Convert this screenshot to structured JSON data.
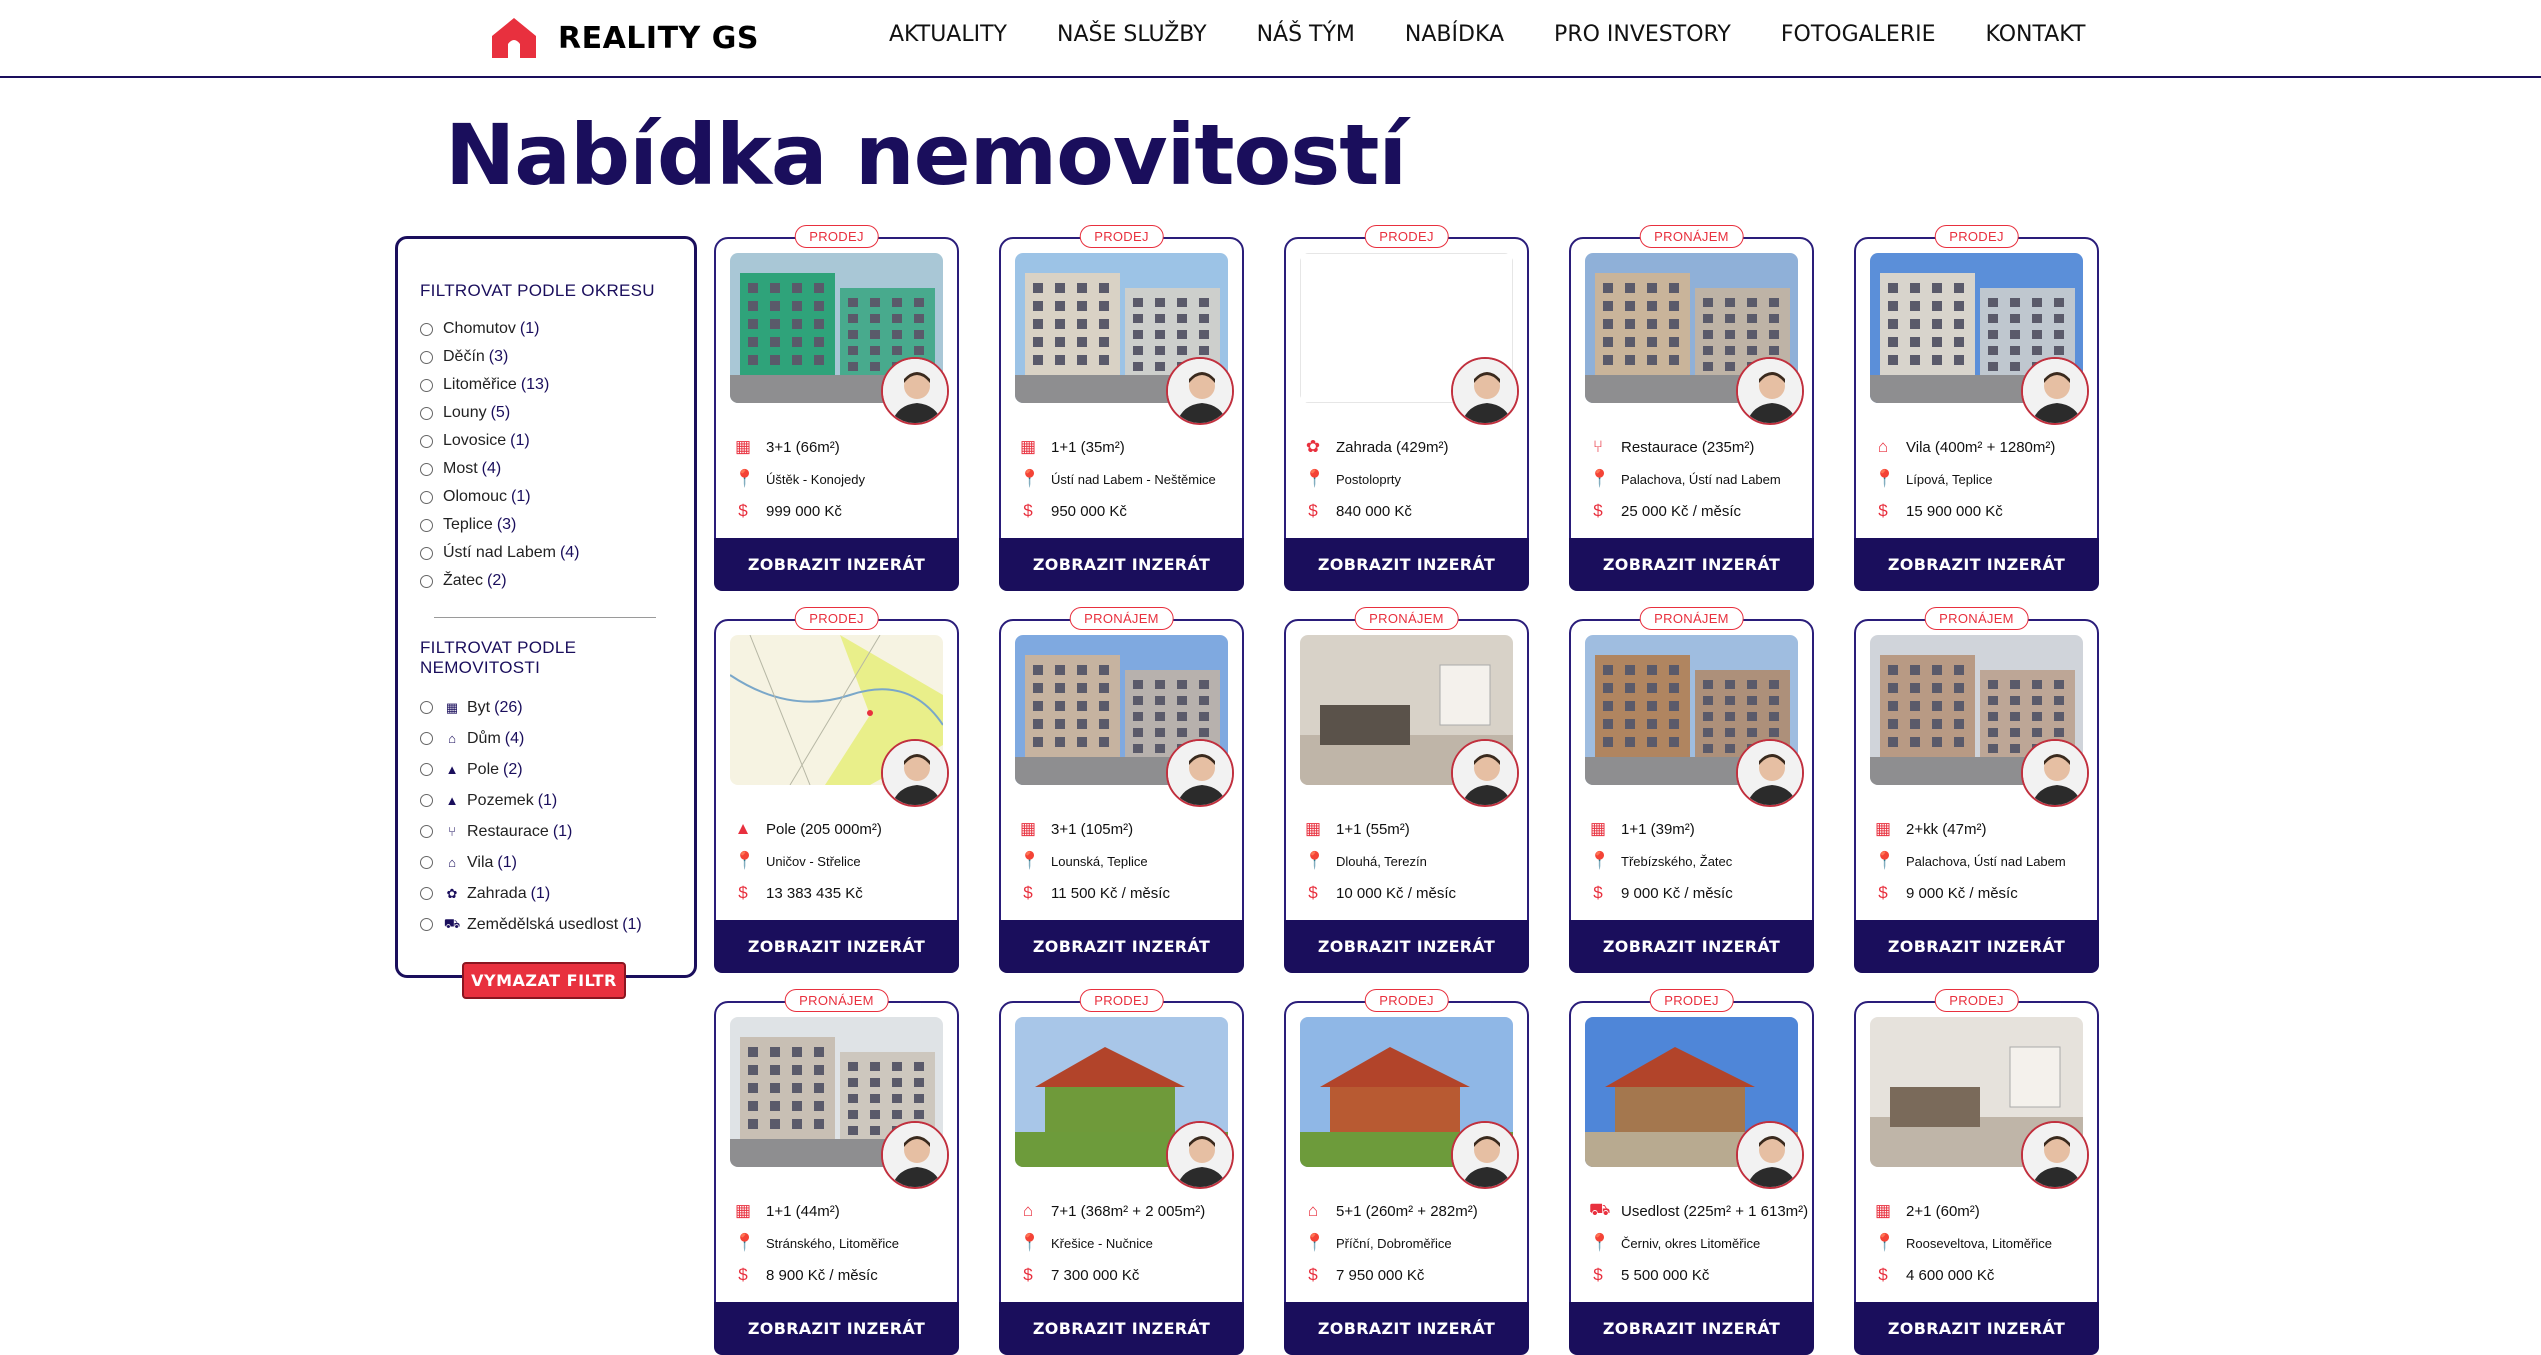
{
  "brand": {
    "name": "REALITY GS"
  },
  "nav": [
    "AKTUALITY",
    "NAŠE SLUŽBY",
    "NÁŠ TÝM",
    "NABÍDKA",
    "PRO INVESTORY",
    "FOTOGALERIE",
    "KONTAKT"
  ],
  "page_title": "Nabídka nemovitostí",
  "sidebar": {
    "district_heading": "FILTROVAT PODLE OKRESU",
    "districts": [
      {
        "label": "Chomutov",
        "count": "(1)"
      },
      {
        "label": "Děčín",
        "count": "(3)"
      },
      {
        "label": "Litoměřice",
        "count": "(13)"
      },
      {
        "label": "Louny",
        "count": "(5)"
      },
      {
        "label": "Lovosice",
        "count": "(1)"
      },
      {
        "label": "Most",
        "count": "(4)"
      },
      {
        "label": "Olomouc",
        "count": "(1)"
      },
      {
        "label": "Teplice",
        "count": "(3)"
      },
      {
        "label": "Ústí nad Labem",
        "count": "(4)"
      },
      {
        "label": "Žatec",
        "count": "(2)"
      }
    ],
    "type_heading": "FILTROVAT PODLE NEMOVITOSTI",
    "types": [
      {
        "label": "Byt",
        "count": "(26)",
        "icon": "building-icon"
      },
      {
        "label": "Dům",
        "count": "(4)",
        "icon": "house-icon"
      },
      {
        "label": "Pole",
        "count": "(2)",
        "icon": "field-icon"
      },
      {
        "label": "Pozemek",
        "count": "(1)",
        "icon": "land-icon"
      },
      {
        "label": "Restaurace",
        "count": "(1)",
        "icon": "restaurant-icon"
      },
      {
        "label": "Vila",
        "count": "(1)",
        "icon": "villa-icon"
      },
      {
        "label": "Zahrada",
        "count": "(1)",
        "icon": "garden-icon"
      },
      {
        "label": "Zemědělská usedlost",
        "count": "(1)",
        "icon": "farm-icon"
      }
    ],
    "clear_button": "VYMAZAT FILTR"
  },
  "card_button": "ZOBRAZIT INZERÁT",
  "listings": [
    {
      "badge": "PRODEJ",
      "title": "3+1 (66m²)",
      "location": "Úštěk - Konojedy",
      "price": "999 000 Kč",
      "icon": "building-icon",
      "photo": "green-apartment-block",
      "colors": [
        "#2fa37a",
        "#a9c7d6"
      ]
    },
    {
      "badge": "PRODEJ",
      "title": "1+1 (35m²)",
      "location": "Ústí nad Labem - Neštěmice",
      "price": "950 000 Kč",
      "icon": "building-icon",
      "photo": "apartment-block",
      "colors": [
        "#d9d2c5",
        "#9cc3e6"
      ]
    },
    {
      "badge": "PRODEJ",
      "title": "Zahrada (429m²)",
      "location": "Postoloprty",
      "price": "840 000 Kč",
      "icon": "garden-icon",
      "photo": "broken-image",
      "colors": [
        "#ffffff",
        "#ffffff"
      ]
    },
    {
      "badge": "PRONÁJEM",
      "title": "Restaurace (235m²)",
      "location": "Palachova, Ústí nad Labem",
      "price": "25 000 Kč / měsíc",
      "icon": "restaurant-icon",
      "photo": "street-buildings",
      "colors": [
        "#c9b49a",
        "#8fb0d8"
      ]
    },
    {
      "badge": "PRODEJ",
      "title": "Vila (400m² + 1280m²)",
      "location": "Lípová, Teplice",
      "price": "15 900 000 Kč",
      "icon": "villa-icon",
      "photo": "villa",
      "colors": [
        "#d8d4cc",
        "#5b8fd9"
      ]
    },
    {
      "badge": "PRODEJ",
      "title": "Pole (205 000m²)",
      "location": "Uničov - Střelice",
      "price": "13 383 435 Kč",
      "icon": "field-icon",
      "photo": "cadastral-map",
      "colors": [
        "#f3f0dc",
        "#f3f0dc"
      ]
    },
    {
      "badge": "PRONÁJEM",
      "title": "3+1 (105m²)",
      "location": "Lounská, Teplice",
      "price": "11 500 Kč / měsíc",
      "icon": "building-icon",
      "photo": "street-buildings",
      "colors": [
        "#c6b3a0",
        "#7fa9e0"
      ]
    },
    {
      "badge": "PRONÁJEM",
      "title": "1+1 (55m²)",
      "location": "Dlouhá, Terezín",
      "price": "10 000 Kč / měsíc",
      "icon": "building-icon",
      "photo": "interior-kitchen",
      "colors": [
        "#d8d2c8",
        "#5a524a"
      ]
    },
    {
      "badge": "PRONÁJEM",
      "title": "1+1 (39m²)",
      "location": "Třebízského, Žatec",
      "price": "9 000 Kč / měsíc",
      "icon": "building-icon",
      "photo": "street-buildings",
      "colors": [
        "#b08560",
        "#9fbde0"
      ]
    },
    {
      "badge": "PRONÁJEM",
      "title": "2+kk (47m²)",
      "location": "Palachova, Ústí nad Labem",
      "price": "9 000 Kč / měsíc",
      "icon": "building-icon",
      "photo": "street-buildings",
      "colors": [
        "#b89a84",
        "#d0d4da"
      ]
    },
    {
      "badge": "PRONÁJEM",
      "title": "1+1 (44m²)",
      "location": "Stránského, Litoměřice",
      "price": "8 900 Kč / měsíc",
      "icon": "building-icon",
      "photo": "apartment-block",
      "colors": [
        "#c8bfb4",
        "#dfe3e6"
      ]
    },
    {
      "badge": "PRODEJ",
      "title": "7+1 (368m² + 2 005m²)",
      "location": "Křešice - Nučnice",
      "price": "7 300 000 Kč",
      "icon": "house-icon",
      "photo": "house-garden",
      "colors": [
        "#6f9a3a",
        "#a8c6e8"
      ]
    },
    {
      "badge": "PRODEJ",
      "title": "5+1 (260m² + 282m²)",
      "location": "Příční, Dobroměřice",
      "price": "7 950 000 Kč",
      "icon": "house-icon",
      "photo": "house-garden",
      "colors": [
        "#b85a32",
        "#8fb7e6"
      ]
    },
    {
      "badge": "PRODEJ",
      "title": "Usedlost (225m² + 1 613m²)",
      "location": "Černiv, okres Litoměřice",
      "price": "5 500 000 Kč",
      "icon": "farm-icon",
      "photo": "farmyard",
      "colors": [
        "#a4774e",
        "#4f86d8"
      ]
    },
    {
      "badge": "PRODEJ",
      "title": "2+1 (60m²)",
      "location": "Rooseveltova, Litoměřice",
      "price": "4 600 000 Kč",
      "icon": "building-icon",
      "photo": "interior-living",
      "colors": [
        "#e6e2dc",
        "#7a6a5a"
      ]
    }
  ]
}
